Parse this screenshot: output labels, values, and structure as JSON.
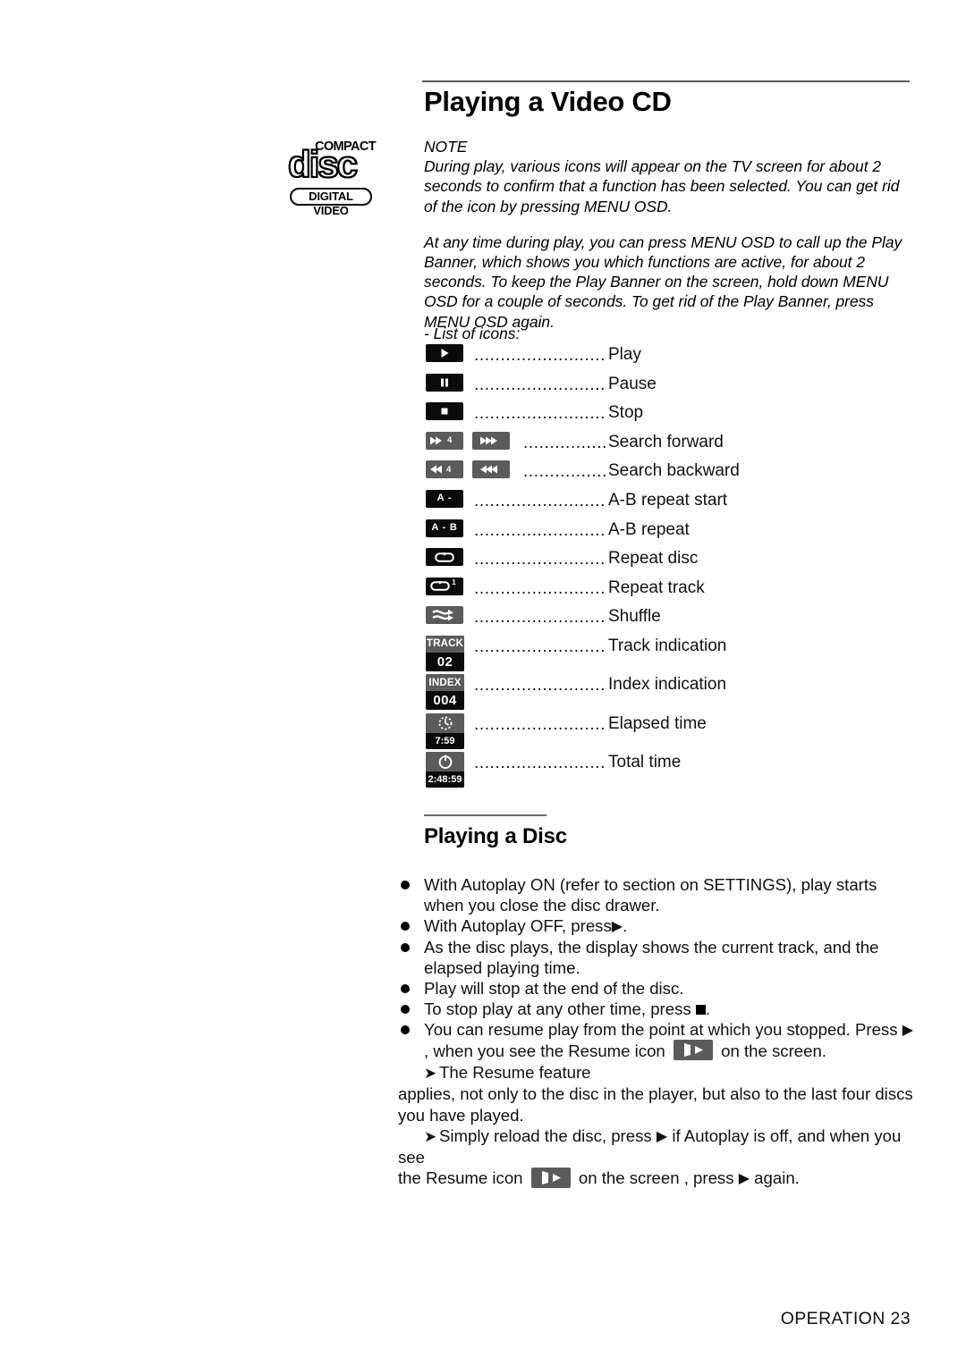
{
  "document": {
    "page_title": "Playing a Video CD",
    "footer": "OPERATION 23"
  },
  "logo": {
    "compact": "COMPACT",
    "disc": "disc",
    "digital_video": "DIGITAL VIDEO"
  },
  "note": {
    "heading": "NOTE",
    "paragraph1": "During play, various icons will appear on the TV screen for about 2 seconds to confirm that a function has been selected. You can get rid of the icon by pressing MENU OSD.",
    "paragraph2": "At any time during play, you can press MENU OSD to call up the Play Banner, which shows you which functions are active, for about 2 seconds. To keep the Play Banner on the screen, hold down MENU OSD for a couple of seconds. To get rid of the Play Banner, press MENU OSD again.",
    "list_intro": "- List of icons:"
  },
  "icon_list": {
    "dots": "........................................",
    "rows": [
      {
        "label": "Play",
        "icon": "play-icon",
        "chip_text": ""
      },
      {
        "label": "Pause",
        "icon": "pause-icon",
        "chip_text": ""
      },
      {
        "label": "Stop",
        "icon": "stop-icon",
        "chip_text": ""
      },
      {
        "label": "Search forward",
        "icon": "search-forward-icon",
        "chip_text": "4"
      },
      {
        "label": "Search backward",
        "icon": "search-backward-icon",
        "chip_text": "4"
      },
      {
        "label": "A-B repeat start",
        "icon": "ab-repeat-start-icon",
        "chip_text": "A -"
      },
      {
        "label": "A-B repeat",
        "icon": "ab-repeat-icon",
        "chip_text": "A - B"
      },
      {
        "label": "Repeat disc",
        "icon": "repeat-disc-icon",
        "chip_text": ""
      },
      {
        "label": "Repeat track",
        "icon": "repeat-track-icon",
        "chip_text": "1"
      },
      {
        "label": "Shuffle",
        "icon": "shuffle-icon",
        "chip_text": ""
      },
      {
        "label": "Track indication",
        "icon": "track-indication-icon",
        "chip_top": "TRACK",
        "chip_bottom": "02"
      },
      {
        "label": "Index indication",
        "icon": "index-indication-icon",
        "chip_top": "INDEX",
        "chip_bottom": "004"
      },
      {
        "label": "Elapsed time",
        "icon": "elapsed-time-icon",
        "chip_bottom": "7:59"
      },
      {
        "label": "Total time",
        "icon": "total-time-icon",
        "chip_bottom": "2:48:59"
      }
    ]
  },
  "playing_a_disc": {
    "heading": "Playing a Disc",
    "bullets": [
      "With Autoplay ON (refer to section on SETTINGS), play starts when you close the disc drawer.",
      "With Autoplay OFF, press",
      "As the disc plays, the display shows the current track, and the elapsed playing time.",
      "Play will stop at the end of the disc.",
      "To stop play at any other time, press",
      "You can resume play from the point at which you stopped. Press"
    ],
    "bullet2_suffix": ".",
    "bullet5_suffix": ".",
    "bullet6_cont": ", when you see the Resume icon",
    "bullet6_tail": "on the screen.",
    "arrow1_label": "The Resume feature",
    "arrow1_body": "applies, not only to the disc in the player, but also to the last four discs you have played.",
    "arrow2_part1": "Simply reload the disc, press",
    "arrow2_part2": "if Autoplay is off, and when you see",
    "arrow2_part3": "the Resume icon",
    "arrow2_part4": "on the screen , press",
    "arrow2_part5": "again.",
    "arrow_glyph": "➤"
  },
  "colors": {
    "chip_black": "#0b0b0b",
    "chip_gray": "#5b5b5b",
    "rule": "#5a5a5a",
    "text": "#111111"
  }
}
